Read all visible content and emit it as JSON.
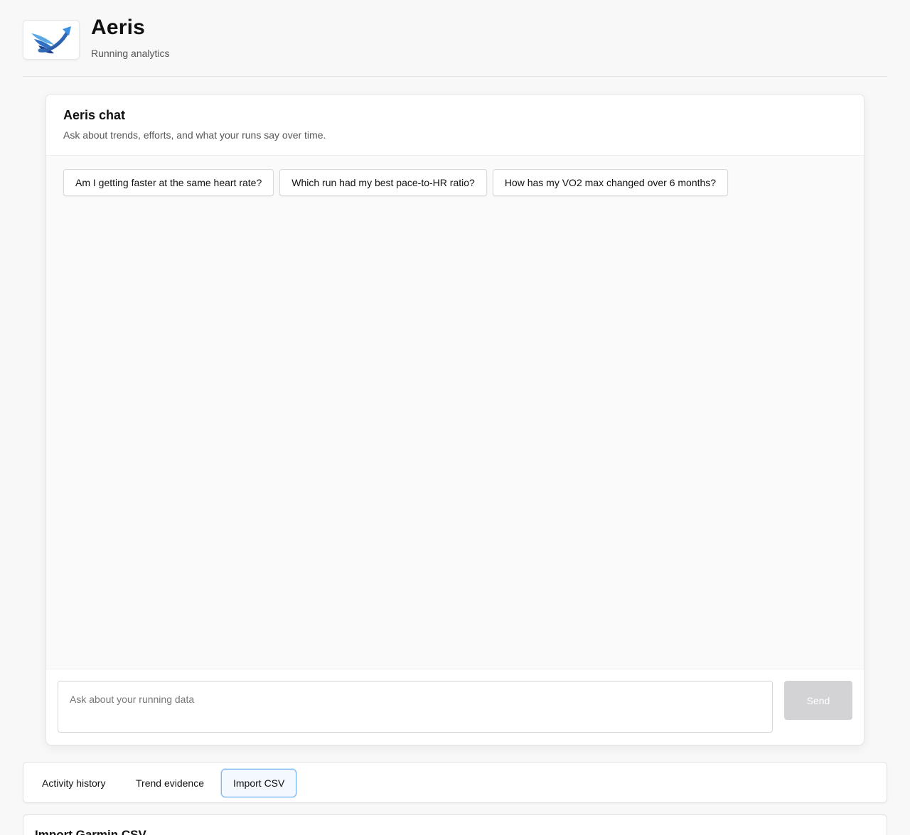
{
  "app": {
    "title": "Aeris",
    "subtitle": "Running analytics",
    "logo_icon": "winged-arrow-logo"
  },
  "chat": {
    "title": "Aeris chat",
    "description": "Ask about trends, efforts, and what your runs say over time.",
    "suggestions": [
      "Am I getting faster at the same heart rate?",
      "Which run had my best pace-to-HR ratio?",
      "How has my VO2 max changed over 6 months?"
    ],
    "input_placeholder": "Ask about your running data",
    "input_value": "",
    "send_label": "Send"
  },
  "tabs": [
    {
      "label": "Activity history",
      "active": false
    },
    {
      "label": "Trend evidence",
      "active": false
    },
    {
      "label": "Import CSV",
      "active": true
    }
  ],
  "import_section": {
    "title": "Import Garmin CSV"
  },
  "colors": {
    "accent": "#7eb6f4",
    "send_disabled": "#d3d3d6",
    "logo_dark": "#1e3f8f",
    "logo_light": "#4a9ee0"
  }
}
